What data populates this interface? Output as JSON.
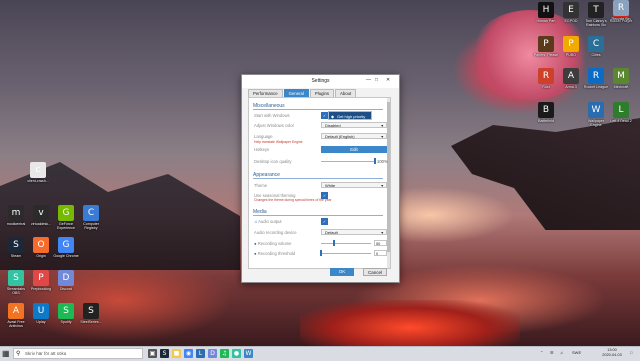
{
  "desktop": {
    "left_icons": [
      {
        "label": "client-crash...",
        "icon": "document-icon",
        "color": "#e8e8e8"
      },
      {
        "label": "modicentral",
        "icon": "puzzle-icon",
        "color": "#2b2b2b"
      },
      {
        "label": "virtualdesk...",
        "icon": "puzzle-icon",
        "color": "#2b2b2b"
      },
      {
        "label": "GeForce Experience",
        "icon": "nvidia-icon",
        "color": "#76b900"
      },
      {
        "label": "Computer Registry",
        "icon": "gear-icon",
        "color": "#3a7bd5"
      },
      {
        "label": "Steam",
        "icon": "steam-icon",
        "color": "#1b2838"
      },
      {
        "label": "Origin",
        "icon": "origin-icon",
        "color": "#f56c2d"
      },
      {
        "label": "Google Chrome",
        "icon": "chrome-icon",
        "color": "#4285f4"
      },
      {
        "label": "Streamlabs OBS",
        "icon": "streamlabs-icon",
        "color": "#31c3a2"
      },
      {
        "label": "Prepbooking",
        "icon": "prep-icon",
        "color": "#e04848"
      },
      {
        "label": "Discord",
        "icon": "discord-icon",
        "color": "#7289da"
      },
      {
        "label": "Avast Free Antivirus",
        "icon": "avast-icon",
        "color": "#f27421"
      },
      {
        "label": "Uplay",
        "icon": "uplay-icon",
        "color": "#0d7ac9"
      },
      {
        "label": "Spotify",
        "icon": "spotify-icon",
        "color": "#1db954"
      },
      {
        "label": "SteelSeries...",
        "icon": "steelseries-icon",
        "color": "#222"
      }
    ],
    "right_icons": [
      {
        "label": "Hitman Part",
        "icon": "hitman-icon",
        "color": "#111"
      },
      {
        "label": "EGPOD",
        "icon": "game-icon",
        "color": "#333"
      },
      {
        "label": "Tom Clancy's Rainbow Six",
        "icon": "r6-icon",
        "color": "#222"
      },
      {
        "label": "Roblox Player",
        "icon": "roblox-icon",
        "color": "#e2231a"
      },
      {
        "label": "Papers, Please",
        "icon": "papers-icon",
        "color": "#5a3a1a"
      },
      {
        "label": "PUBG",
        "icon": "pubg-icon",
        "color": "#f2a900"
      },
      {
        "label": "Cities",
        "icon": "cities-icon",
        "color": "#2a6f97"
      },
      {
        "label": "Arma 3",
        "icon": "arma-icon",
        "color": "#3d3d3d"
      },
      {
        "label": "Rust",
        "icon": "rust-icon",
        "color": "#cd412b"
      },
      {
        "label": "Rocket League",
        "icon": "rocket-icon",
        "color": "#0c6cc5"
      },
      {
        "label": "Minecraft",
        "icon": "minecraft-icon",
        "color": "#5b8731"
      },
      {
        "label": "Wallpaper Engine",
        "icon": "wallpaper-icon",
        "color": "#2b6cb0"
      },
      {
        "label": "Left 4 Dead 2",
        "icon": "l4d-icon",
        "color": "#2d7d2d"
      },
      {
        "label": "Battlefield",
        "icon": "battlefield-icon",
        "color": "#1a1a1a"
      },
      {
        "label": "Recycle Bin",
        "icon": "recycle-bin-icon",
        "color": "#8aa2bd"
      }
    ]
  },
  "dialog": {
    "title": "Settings",
    "tabs": [
      "Performance",
      "General",
      "Plugins",
      "About"
    ],
    "active_tab": "General",
    "misc": {
      "heading": "Miscellaneous",
      "start_with_windows": "Start with Windows",
      "adjust_colors": "Adjust Windows color",
      "adjust_colors_value": "Disabled",
      "language": "Language",
      "language_value": "Default (English)",
      "language_note": "Help translate Wallpaper Engine",
      "hotkeys": "Hotkeys",
      "edit_label": "Edit",
      "desktop_icon_quality": "Desktop icon quality",
      "quality_value": "100%",
      "quality_level": 1.0,
      "tooltip": "Get high priority"
    },
    "appearance": {
      "heading": "Appearance",
      "theme": "Theme",
      "theme_value": "White",
      "use_seasonal": "Use seasonal theming",
      "seasonal_note": "Changes the theme during special times of the year"
    },
    "media": {
      "heading": "Media",
      "audio_output": "Audio output",
      "audio_device": "Audio recording device",
      "audio_device_value": "Default",
      "recording_volume": "Recording volume",
      "recording_volume_value": "50",
      "recording_threshold": "Recording threshold",
      "recording_threshold_value": "0"
    },
    "ok_label": "OK",
    "cancel_label": "Cancel"
  },
  "taskbar": {
    "search_placeholder": "Skriv här för att söka",
    "tray_lang": "SWE",
    "time": "13:00",
    "date": "2020-04-03"
  }
}
